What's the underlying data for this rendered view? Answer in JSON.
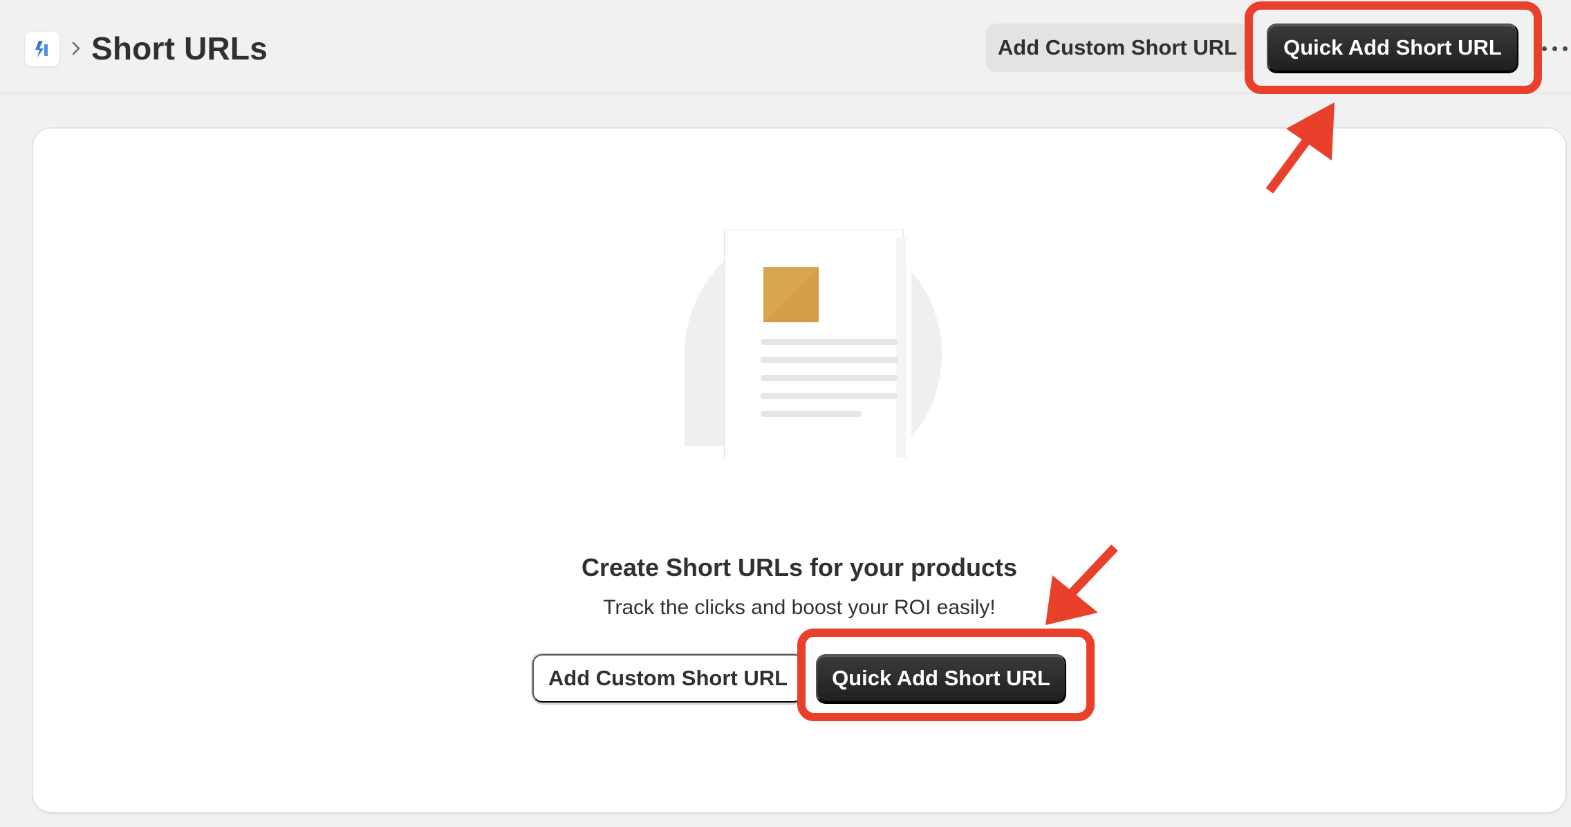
{
  "header": {
    "app_icon": "app-logo-icon",
    "breadcrumb_separator_icon": "chevron-right-icon",
    "title": "Short URLs",
    "add_custom_label": "Add Custom Short URL",
    "quick_add_label": "Quick Add Short URL",
    "more_icon": "more-horizontal-icon"
  },
  "empty_state": {
    "illustration": "document-illustration",
    "heading": "Create Short URLs for your products",
    "subheading": "Track the clicks and boost your ROI easily!",
    "add_custom_label": "Add Custom Short URL",
    "quick_add_label": "Quick Add Short URL"
  },
  "annotations": {
    "color": "#e8402a"
  },
  "colors": {
    "background": "#f1f1f1",
    "primary_button": "#303030",
    "illustration_accent": "#d9a650",
    "app_icon_accent": "#2f7fd1"
  }
}
